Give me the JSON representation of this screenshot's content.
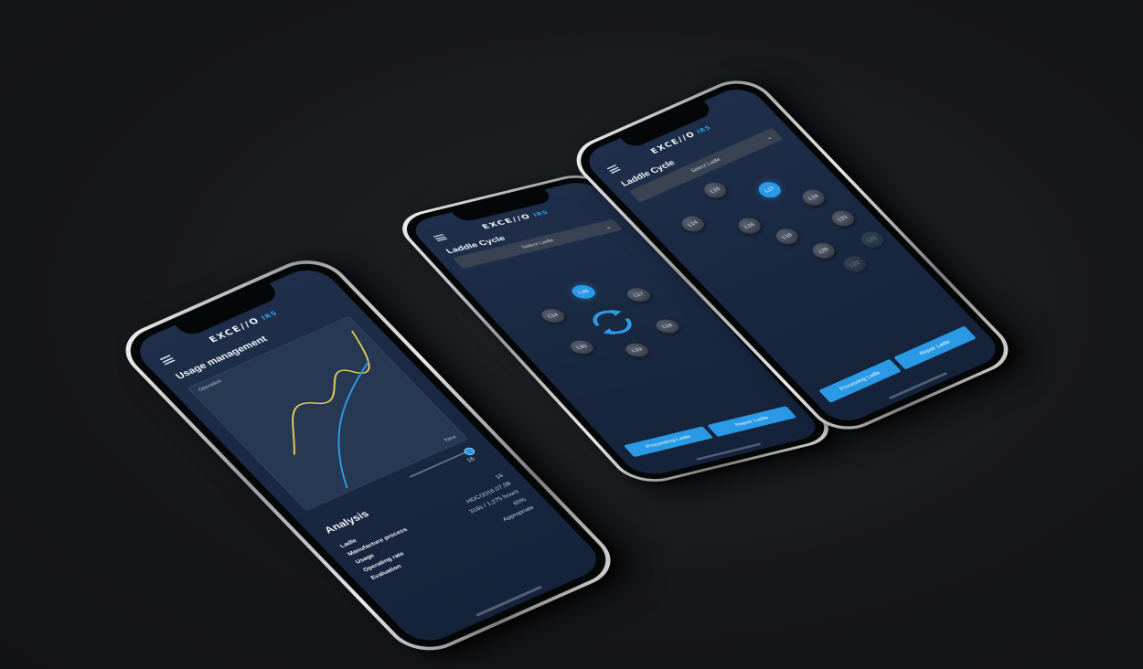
{
  "brand": {
    "name": "EXCE//O",
    "suffix": "IRS"
  },
  "usage_screen": {
    "title": "Usage management",
    "chart_label_y": "Operation",
    "chart_label_x": "Time",
    "slider_value": "16",
    "analysis_title": "Analysis",
    "rows": [
      {
        "key": "Ladle",
        "value": "16"
      },
      {
        "key": "Manufacture process",
        "value": "HDC/2016.07.09"
      },
      {
        "key": "Usage",
        "value": "318s / 1,275 hours"
      },
      {
        "key": "Operating rate",
        "value": "65%"
      },
      {
        "key": "Evaluation",
        "value": "Appropriate"
      }
    ]
  },
  "cycle_screen": {
    "title": "Laddle Cycle",
    "select_placeholder": "Select Ladle",
    "ladles": [
      "L16",
      "L14",
      "L17",
      "L20",
      "L18",
      "L19"
    ],
    "active": "L16",
    "buttons": {
      "processing": "Processing Ladle",
      "repair": "Repair Ladle"
    }
  },
  "grid_screen": {
    "title": "Laddle Cycle",
    "select_placeholder": "Select Ladle",
    "ladles": [
      "L15",
      "L14",
      "L17",
      "L16",
      "L19",
      "L18",
      "L21",
      "L20",
      "L23",
      "L22"
    ],
    "active": "L17",
    "buttons": {
      "processing": "Processing Ladle",
      "repair": "Repair Ladle"
    }
  },
  "colors": {
    "accent": "#2a9ae6",
    "curve_yellow": "#e6cf5a",
    "curve_blue": "#2f9be8"
  }
}
